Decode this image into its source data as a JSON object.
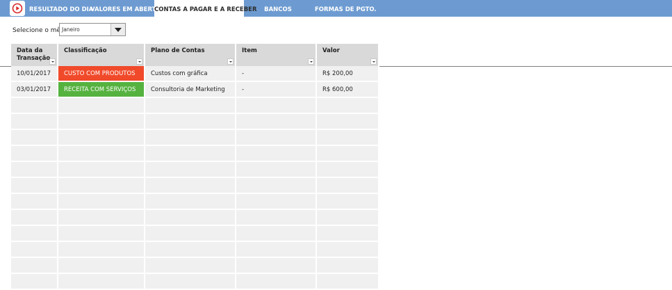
{
  "nav": {
    "tabs": [
      {
        "label": "RESULTADO DO DIA",
        "active": false
      },
      {
        "label": "VALORES EM ABERTO",
        "active": false
      },
      {
        "label": "CONTAS A PAGAR E A RECEBER",
        "active": true
      },
      {
        "label": "BANCOS",
        "active": false
      },
      {
        "label": "FORMAS DE PGTO.",
        "active": false
      }
    ]
  },
  "filter": {
    "month_label": "Selecione o mês:",
    "month_value": "Janeiro"
  },
  "table": {
    "columns": [
      "Data da Transação",
      "Classificação",
      "Plano de Contas",
      "Item",
      "Valor"
    ],
    "rows": [
      {
        "date": "10/01/2017",
        "classificacao": "CUSTO COM PRODUTOS",
        "class_color": "#f04a2a",
        "plano": "Custos com gráfica",
        "item": "-",
        "valor": "R$ 200,00"
      },
      {
        "date": "03/01/2017",
        "classificacao": "RECEITA COM SERVIÇOS",
        "class_color": "#55b23f",
        "plano": "Consultoria de Marketing",
        "item": "-",
        "valor": "R$ 600,00"
      }
    ]
  },
  "colors": {
    "topbar": "#6d9bd1",
    "header_cell": "#d9d9d9",
    "body_cell": "#f0f0f0",
    "expense": "#f04a2a",
    "income": "#55b23f"
  },
  "icons": [
    "play-circle-logo-icon",
    "dropdown-arrow-icon",
    "filter-dropdown-icon"
  ]
}
